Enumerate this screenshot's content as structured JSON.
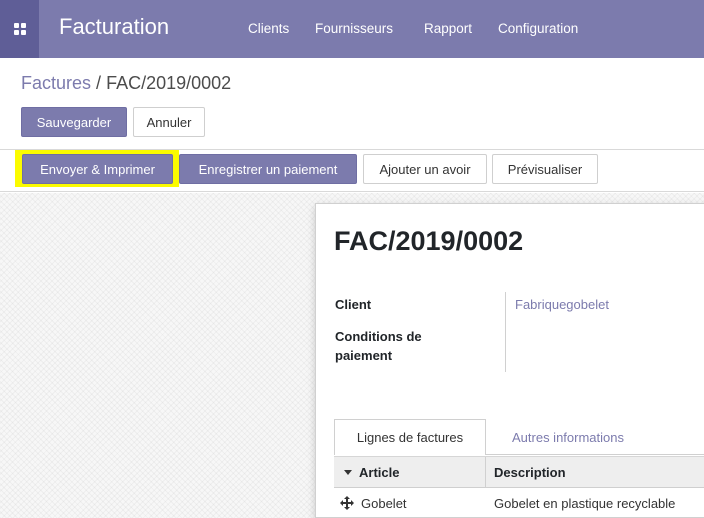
{
  "navbar": {
    "app_title": "Facturation",
    "menu": [
      "Clients",
      "Fournisseurs",
      "Rapport",
      "Configuration"
    ],
    "apps_icon": "apps-grid-icon"
  },
  "breadcrumb": {
    "parent": "Factures",
    "separator": "/",
    "current": "FAC/2019/0002"
  },
  "actions": {
    "save_label": "Sauvegarder",
    "discard_label": "Annuler"
  },
  "statusbar": {
    "buttons": [
      "Envoyer & Imprimer",
      "Enregistrer un paiement",
      "Ajouter un avoir",
      "Prévisualiser"
    ]
  },
  "invoice": {
    "number": "FAC/2019/0002",
    "fields": {
      "client_label": "Client",
      "client_value": "Fabriquegobelet",
      "terms_label_line1": "Conditions de",
      "terms_label_line2": "paiement"
    },
    "tabs": [
      "Lignes de factures",
      "Autres informations"
    ],
    "columns": [
      "Article",
      "Description"
    ],
    "rows": [
      {
        "article": "Gobelet",
        "description": "Gobelet en plastique recyclable"
      }
    ]
  },
  "colors": {
    "brand": "#7c7bad",
    "brand_dark": "#5f5e97",
    "highlight": "#fbfb00"
  }
}
